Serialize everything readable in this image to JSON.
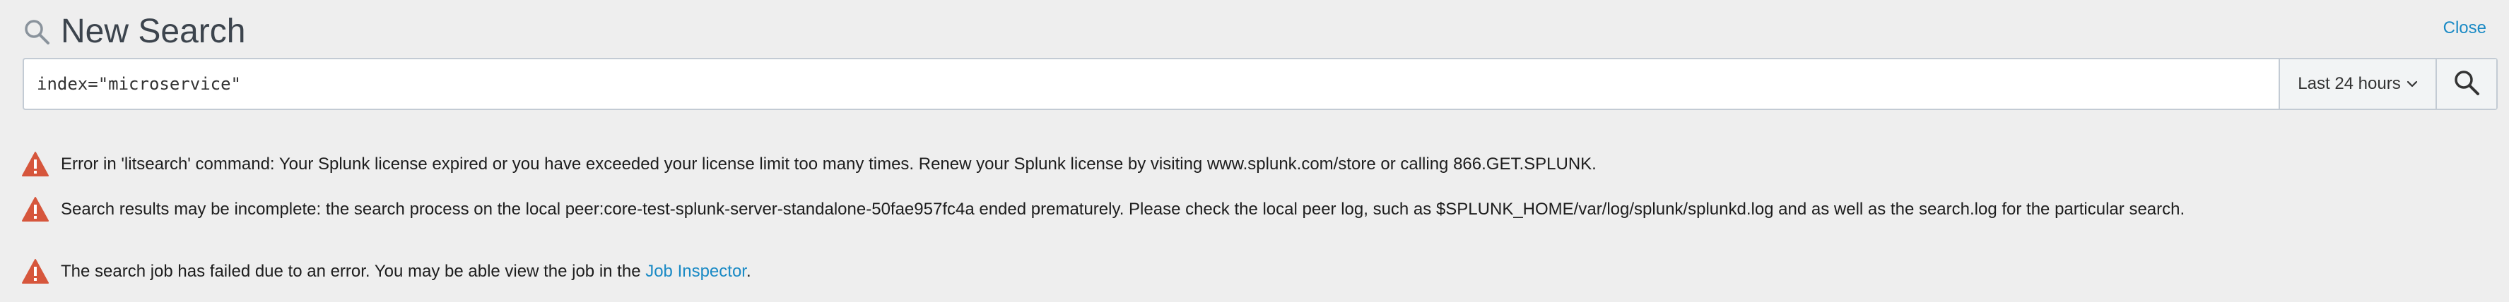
{
  "header": {
    "title": "New Search",
    "close_label": "Close"
  },
  "search": {
    "query": "index=\"microservice\"",
    "time_range": "Last 24 hours"
  },
  "messages": [
    {
      "type": "error",
      "text": "Error in 'litsearch' command: Your Splunk license expired or you have exceeded your license limit too many times. Renew your Splunk license by visiting www.splunk.com/store or calling 866.GET.SPLUNK."
    },
    {
      "type": "error",
      "text": "Search results may be incomplete: the search process on the local peer:core-test-splunk-server-standalone-50fae957fc4a ended prematurely. Please check the local peer log, such as $SPLUNK_HOME/var/log/splunk/splunkd.log and as well as the search.log for the particular search."
    },
    {
      "type": "error",
      "text_before": "The search job has failed due to an error. You may be able view the job in the ",
      "link_text": "Job Inspector",
      "text_after": "."
    }
  ],
  "colors": {
    "background": "#eeeeee",
    "link": "#1a8ac5",
    "error_icon": "#d6563c",
    "border": "#c3cbd4"
  },
  "icons": {
    "title": "magnifier-icon",
    "search_button": "magnifier-icon",
    "time_range": "chevron-down-icon",
    "message": "warning-triangle-icon"
  }
}
